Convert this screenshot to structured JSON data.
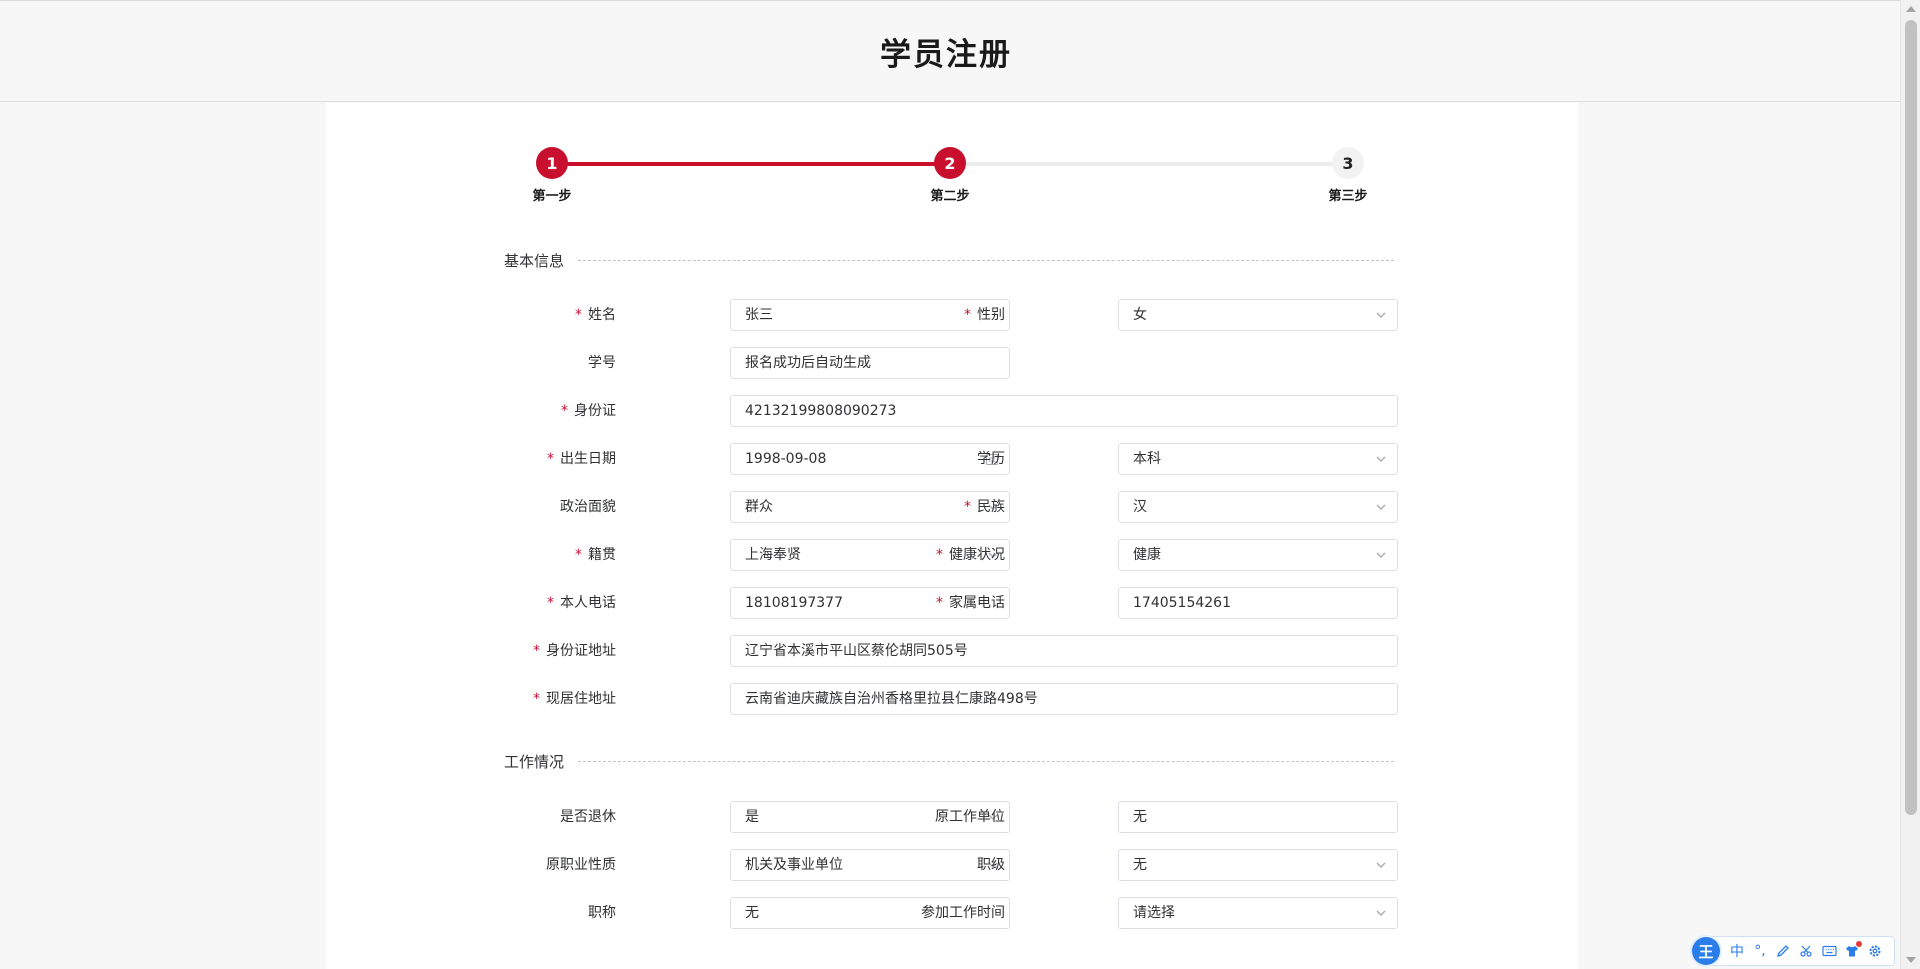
{
  "page": {
    "title": "学员注册"
  },
  "steps": [
    {
      "number": "1",
      "label": "第一步",
      "state": "done"
    },
    {
      "number": "2",
      "label": "第二步",
      "state": "active"
    },
    {
      "number": "3",
      "label": "第三步",
      "state": "pending"
    }
  ],
  "sections": {
    "basic": "基本信息",
    "work": "工作情况"
  },
  "form": {
    "name": {
      "label": "姓名",
      "value": "张三",
      "required": true
    },
    "gender": {
      "label": "性别",
      "value": "女",
      "required": true
    },
    "student_no": {
      "label": "学号",
      "value": "报名成功后自动生成",
      "required": false
    },
    "id_card": {
      "label": "身份证",
      "value": "42132199808090273",
      "required": true
    },
    "birth_date": {
      "label": "出生日期",
      "value": "1998-09-08",
      "required": true
    },
    "education": {
      "label": "学历",
      "value": "本科",
      "required": false
    },
    "political": {
      "label": "政治面貌",
      "value": "群众",
      "required": false
    },
    "ethnicity": {
      "label": "民族",
      "value": "汉",
      "required": true
    },
    "native_place": {
      "label": "籍贯",
      "value": "上海奉贤",
      "required": true
    },
    "health": {
      "label": "健康状况",
      "value": "健康",
      "required": true
    },
    "phone": {
      "label": "本人电话",
      "value": "18108197377",
      "required": true
    },
    "family_phone": {
      "label": "家属电话",
      "value": "17405154261",
      "required": true
    },
    "id_address": {
      "label": "身份证地址",
      "value": "辽宁省本溪市平山区蔡伦胡同505号",
      "required": true
    },
    "current_address": {
      "label": "现居住地址",
      "value": "云南省迪庆藏族自治州香格里拉县仁康路498号",
      "required": true
    },
    "retired": {
      "label": "是否退休",
      "value": "是",
      "required": false
    },
    "former_employer": {
      "label": "原工作单位",
      "value": "无",
      "required": false
    },
    "former_nature": {
      "label": "原职业性质",
      "value": "机关及事业单位",
      "required": false
    },
    "rank": {
      "label": "职级",
      "value": "无",
      "required": false
    },
    "title": {
      "label": "职称",
      "value": "无",
      "required": false
    },
    "work_start": {
      "label": "参加工作时间",
      "value": "请选择",
      "required": false
    }
  },
  "ime": {
    "logo": "王",
    "mode": "中",
    "punct": "°,",
    "icons": [
      "pen-icon",
      "scissors-icon",
      "keyboard-icon",
      "shirt-icon",
      "gear-icon"
    ]
  },
  "colors": {
    "accent": "#c8102e",
    "border": "#dcdfe6",
    "ime": "#2b7de9"
  }
}
